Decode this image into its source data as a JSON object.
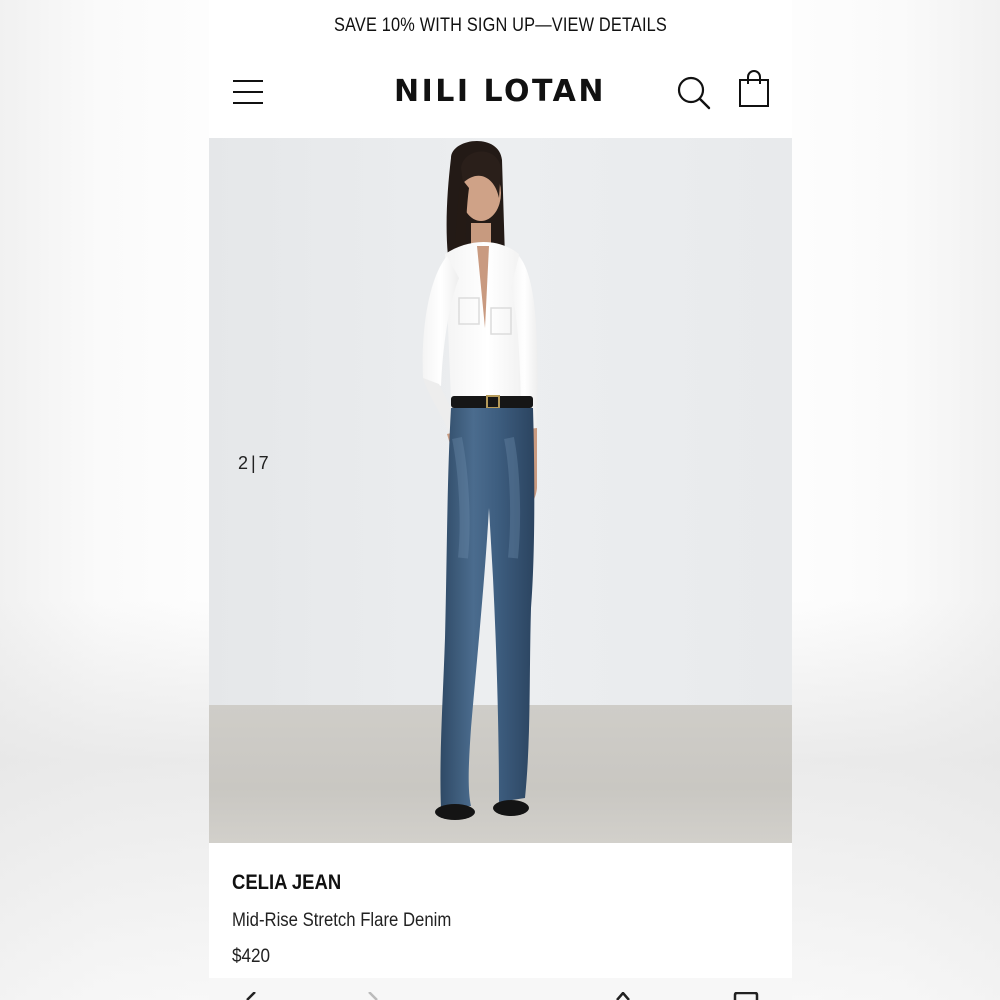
{
  "promo": {
    "text": "SAVE 10% WITH SIGN UP—VIEW DETAILS"
  },
  "header": {
    "logo": "NILI LOTAN",
    "menu_icon": "hamburger-menu-icon",
    "search_icon": "search-icon",
    "cart_icon": "shopping-bag-icon"
  },
  "gallery": {
    "counter": "2|7"
  },
  "product": {
    "name": "CELIA JEAN",
    "description": "Mid-Rise Stretch Flare Denim",
    "price": "$420"
  },
  "browser_nav": {
    "icons": [
      "back-icon",
      "forward-icon",
      "share-icon",
      "tabs-icon"
    ]
  },
  "colors": {
    "text": "#111111",
    "background": "#ffffff",
    "wall": "#e9ebed",
    "floor": "#cbc9c4",
    "denim": "#3d5a78"
  }
}
